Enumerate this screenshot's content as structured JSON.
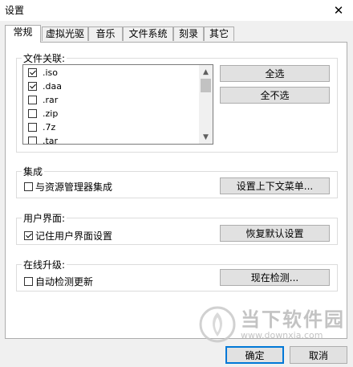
{
  "window": {
    "title": "设置",
    "close_glyph": "✕"
  },
  "tabs": [
    {
      "label": "常规",
      "active": true
    },
    {
      "label": "虚拟光驱",
      "active": false
    },
    {
      "label": "音乐",
      "active": false
    },
    {
      "label": "文件系统",
      "active": false
    },
    {
      "label": "刻录",
      "active": false
    },
    {
      "label": "其它",
      "active": false
    }
  ],
  "file_assoc": {
    "legend": "文件关联:",
    "items": [
      {
        "label": ".iso",
        "checked": true
      },
      {
        "label": ".daa",
        "checked": true
      },
      {
        "label": ".rar",
        "checked": false
      },
      {
        "label": ".zip",
        "checked": false
      },
      {
        "label": ".7z",
        "checked": false
      },
      {
        "label": ".tar",
        "checked": false
      }
    ],
    "select_all": "全选",
    "select_none": "全不选"
  },
  "integration": {
    "legend": "集成",
    "checkbox_label": "与资源管理器集成",
    "checked": false,
    "button": "设置上下文菜单..."
  },
  "ui_section": {
    "legend": "用户界面:",
    "checkbox_label": "记住用户界面设置",
    "checked": true,
    "button": "恢复默认设置"
  },
  "online_upgrade": {
    "legend": "在线升级:",
    "checkbox_label": "自动检测更新",
    "checked": false,
    "button": "现在检测..."
  },
  "footer": {
    "ok": "确定",
    "cancel": "取消"
  },
  "watermark": {
    "brand": "当下软件园",
    "url": "www.downxia.com"
  }
}
